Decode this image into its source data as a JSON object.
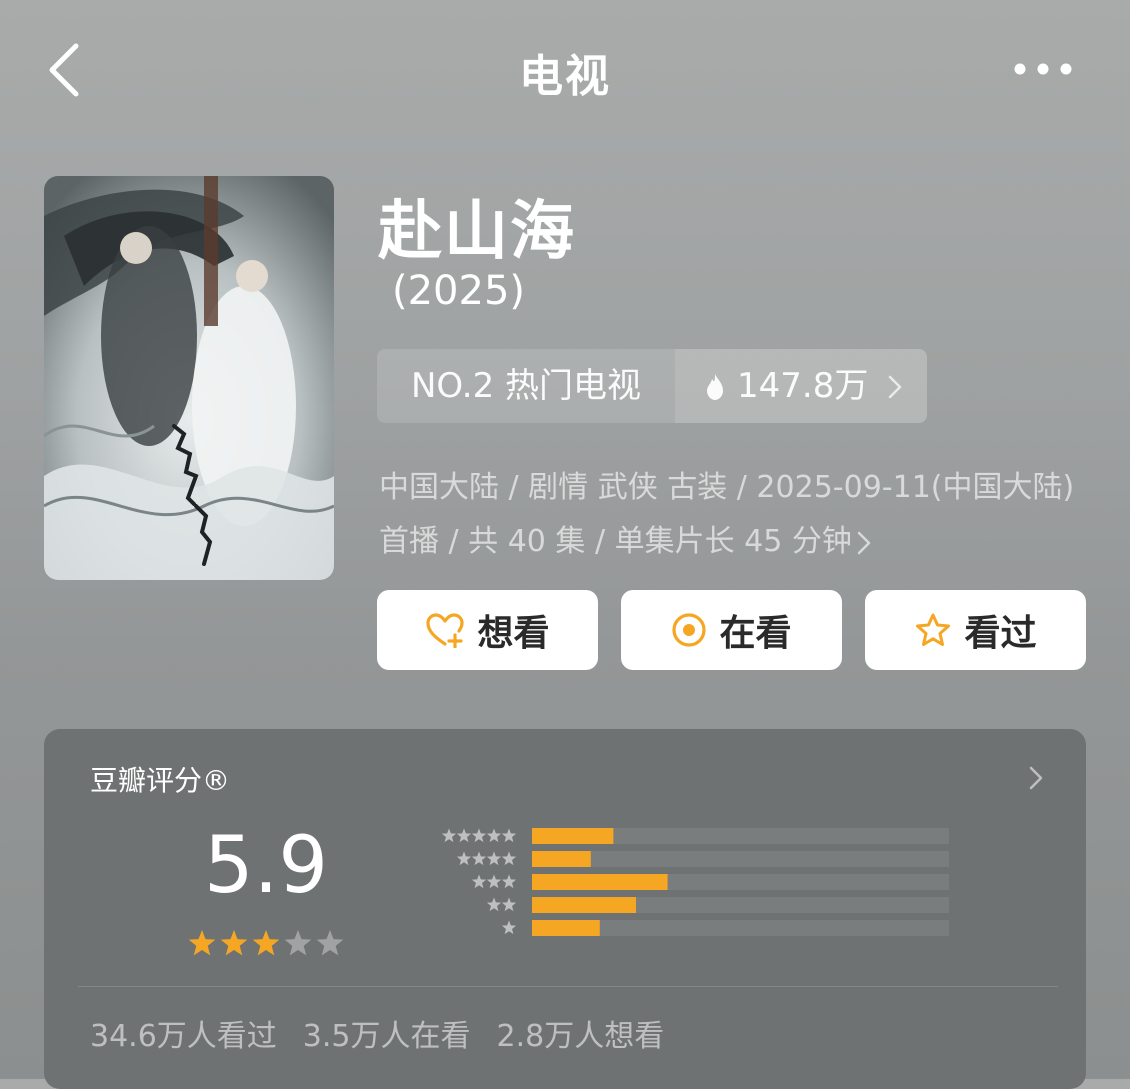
{
  "header": {
    "title": "电视",
    "back_icon": "chevron-left-icon",
    "more_icon": "more-horizontal-icon"
  },
  "show": {
    "name": "赴山海",
    "year": "(2025)",
    "rank_label": "NO.2 热门电视",
    "heat_value": "147.8万",
    "meta": "中国大陆 / 剧情 武侠 古装 / 2025-09-11(中国大陆) 首播 / 共 40 集 / 单集片长 45 分钟"
  },
  "actions": {
    "want_label": "想看",
    "watching_label": "在看",
    "watched_label": "看过"
  },
  "rating": {
    "label": "豆瓣评分®",
    "score": "5.9",
    "star_value": 3,
    "star_max": 5,
    "distribution_fraction": [
      {
        "stars": 5,
        "fraction": 0.18
      },
      {
        "stars": 4,
        "fraction": 0.13
      },
      {
        "stars": 3,
        "fraction": 0.3
      },
      {
        "stars": 2,
        "fraction": 0.23
      },
      {
        "stars": 1,
        "fraction": 0.15
      }
    ]
  },
  "stats": {
    "watched": "34.6万人看过",
    "watching": "3.5万人在看",
    "want": "2.8万人想看"
  },
  "colors": {
    "accent_orange": "#f5a623",
    "background": "#9fa2a2",
    "card": "#6f7272"
  }
}
